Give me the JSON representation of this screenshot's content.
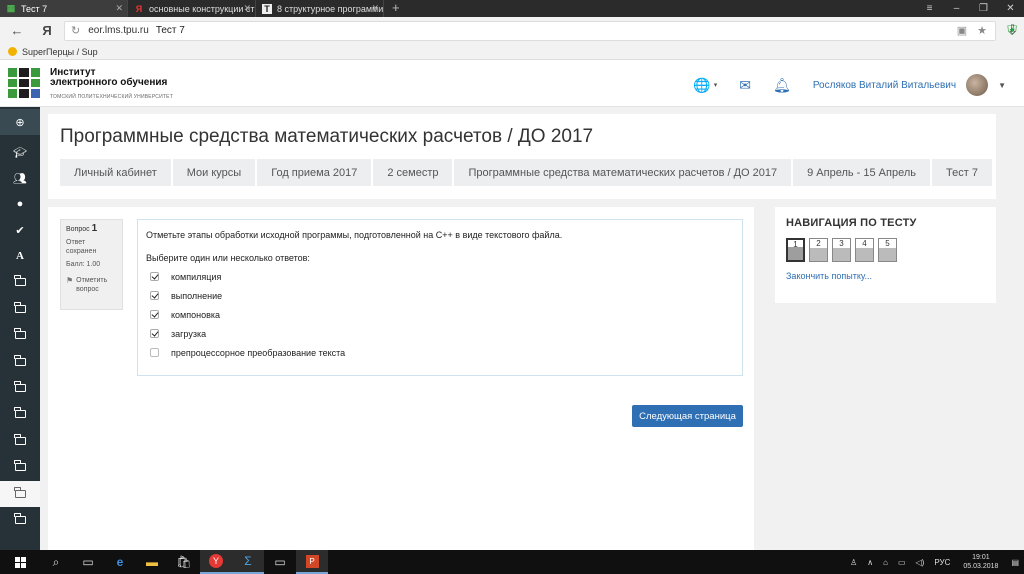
{
  "browser": {
    "tabs": [
      {
        "title": "Тест 7",
        "active": true,
        "icon": "moodle-tab-icon"
      },
      {
        "title": "основные конструкции стр",
        "active": false,
        "icon": "yandex-icon"
      },
      {
        "title": "8 структурное программир",
        "active": false,
        "icon": "t-icon"
      }
    ],
    "address": {
      "host": "eor.lms.tpu.ru",
      "page_title": "Тест 7"
    },
    "bookmark": "SuperПерцы / Sup"
  },
  "site": {
    "logo_line1": "Институт",
    "logo_line2": "электронного обучения",
    "logo_line3": "ТОМСКИЙ ПОЛИТЕХНИЧЕСКИЙ УНИВЕРСИТЕТ",
    "user_name": "Росляков Виталий Витальевич",
    "accent": "#2f6fb3"
  },
  "course": {
    "title": "Программные средства математических расчетов / ДО 2017",
    "breadcrumb": [
      "Личный кабинет",
      "Мои курсы",
      "Год приема 2017",
      "2 семестр",
      "Программные средства математических расчетов / ДО 2017",
      "9 Апрель - 15 Апрель",
      "Тест 7"
    ]
  },
  "question": {
    "label": "Вопрос",
    "number": "1",
    "state": "Ответ сохранен",
    "grade": "Балл: 1.00",
    "flag": "Отметить вопрос",
    "text": "Отметьте этапы обработки исходной программы, подготовленной на С++ в виде текстового файла.",
    "prompt": "Выберите один или несколько ответов:",
    "answers": [
      {
        "label": "компиляция",
        "checked": true
      },
      {
        "label": "выполнение",
        "checked": true
      },
      {
        "label": "компоновка",
        "checked": true
      },
      {
        "label": "загрузка",
        "checked": true
      },
      {
        "label": "препроцессорное преобразование текста",
        "checked": false
      }
    ],
    "next_button": "Следующая страница"
  },
  "navigation": {
    "title": "НАВИГАЦИЯ ПО ТЕСТУ",
    "questions": [
      "1",
      "2",
      "3",
      "4",
      "5"
    ],
    "current": "1",
    "finish_link": "Закончить попытку..."
  },
  "taskbar": {
    "lang": "РУС",
    "time": "19:01",
    "date": "05.03.2018"
  }
}
